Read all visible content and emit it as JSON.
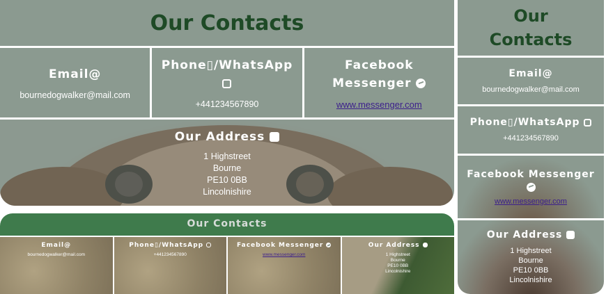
{
  "large": {
    "title": "Our Contacts",
    "email_label": "Email@",
    "email_value": "bournedogwalker@mail.com",
    "phone_label": "Phone▯/WhatsApp",
    "phone_value": "+441234567890",
    "facebook_label": "Facebook Messenger",
    "facebook_link": "www.messenger.com",
    "address_label": "Our Address",
    "address_lines": [
      "1 Highstreet",
      "Bourne",
      "PE10 0BB",
      "Lincolnishire"
    ]
  },
  "banner": {
    "title": "Our Contacts",
    "email_label": "Email@",
    "email_value": "bournedogwalker@mail.com",
    "phone_label": "Phone▯/WhatsApp",
    "phone_value": "+441234567890",
    "facebook_label": "Facebook Messenger",
    "facebook_link": "www.messenger.com",
    "address_label": "Our Address",
    "address_lines": [
      "1 Highstreet",
      "Bourne",
      "PE10 0BB",
      "Lincolnishire"
    ]
  },
  "mobile": {
    "title_line1": "Our",
    "title_line2": "Contacts",
    "email_label": "Email@",
    "email_value": "bournedogwalker@mail.com",
    "phone_label": "Phone▯/WhatsApp",
    "phone_value": "+441234567890",
    "facebook_label": "Facebook Messenger",
    "facebook_link": "www.messenger.com",
    "address_label": "Our Address",
    "address_lines": [
      "1 Highstreet",
      "Bourne",
      "PE10 0BB",
      "Lincolnishire"
    ]
  },
  "icons": {
    "whatsapp": "whatsapp-icon",
    "messenger": "messenger-icon",
    "address": "contact-card-icon"
  },
  "colors": {
    "panel": "#8b9a90",
    "heading": "#1e4a26",
    "banner": "#3f7b4c",
    "link": "#3b1e8c"
  }
}
